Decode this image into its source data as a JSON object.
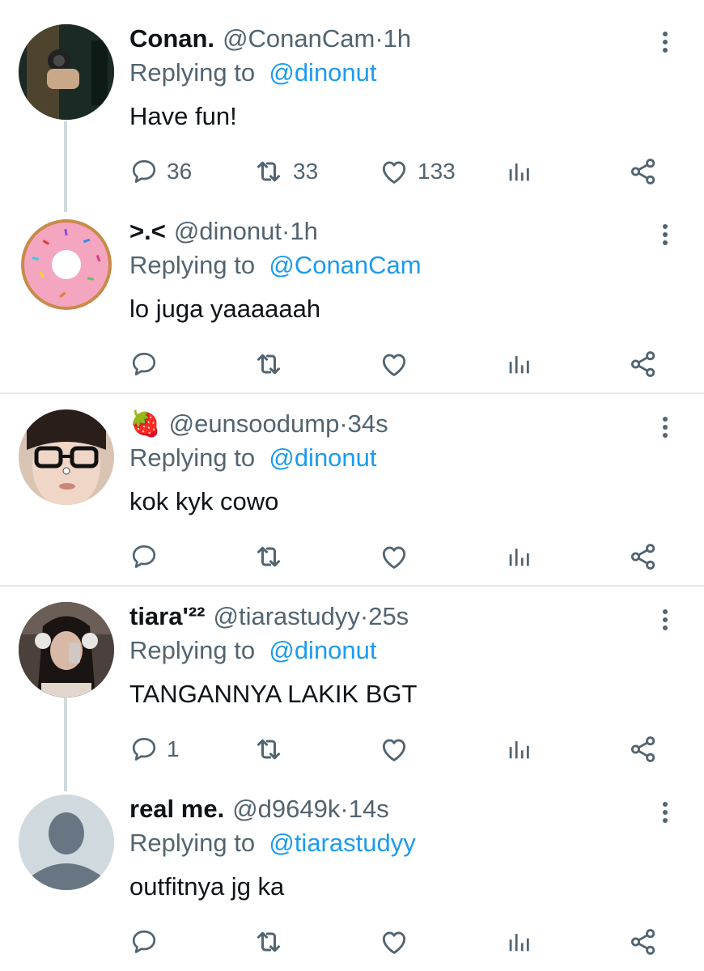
{
  "replying_prefix": "Replying to",
  "tweets": [
    {
      "name": "Conan.",
      "handle": "@ConanCam",
      "time_sep": " · ",
      "time": "1h",
      "replying_to": "@dinonut",
      "text": "Have fun!",
      "counts": {
        "reply": "36",
        "retweet": "33",
        "like": "133"
      }
    },
    {
      "name": ">.<",
      "handle": "@dinonut",
      "time_sep": " · ",
      "time": "1h",
      "replying_to": "@ConanCam",
      "text": "lo juga yaaaaaah",
      "counts": {
        "reply": "",
        "retweet": "",
        "like": ""
      }
    },
    {
      "name": "🍓",
      "handle": "@eunsoodump",
      "time_sep": " · ",
      "time": "34s",
      "replying_to": "@dinonut",
      "text": "kok kyk cowo",
      "counts": {
        "reply": "",
        "retweet": "",
        "like": ""
      }
    },
    {
      "name": "tiara'²²",
      "handle": "@tiarastudyy",
      "time_sep": " · ",
      "time": "25s",
      "replying_to": "@dinonut",
      "text": "TANGANNYA LAKIK BGT",
      "counts": {
        "reply": "1",
        "retweet": "",
        "like": ""
      }
    },
    {
      "name": "real me.",
      "handle": "@d9649k",
      "time_sep": " · ",
      "time": "14s",
      "replying_to": "@tiarastudyy",
      "text": "outfitnya jg ka",
      "counts": {
        "reply": "",
        "retweet": "",
        "like": ""
      }
    }
  ],
  "colors": {
    "link": "#1d9bf0",
    "secondary_text": "#536471",
    "primary_text": "#0f1419",
    "divider": "#e6e9ec"
  },
  "icons": {
    "reply": "speech-bubble-icon",
    "retweet": "retweet-arrows-icon",
    "like": "heart-icon",
    "views": "bar-chart-icon",
    "share": "share-nodes-icon",
    "more": "vertical-ellipsis-icon"
  }
}
